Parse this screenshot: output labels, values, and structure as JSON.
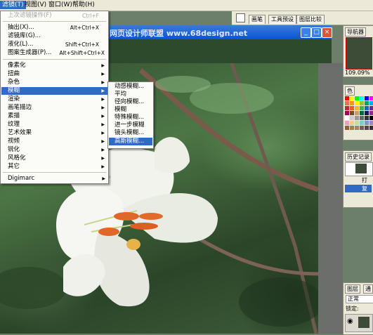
{
  "menubar": {
    "items": [
      {
        "label": "滤镜(T)",
        "active": true
      },
      {
        "label": "视图(V)",
        "active": false
      },
      {
        "label": "窗口(W)",
        "active": false
      },
      {
        "label": "帮助(H)",
        "active": false
      }
    ]
  },
  "filter_menu": {
    "items": [
      {
        "label": "上次滤镜操作(F)",
        "shortcut": "Ctrl+F",
        "disabled": true
      },
      {
        "label": "抽出(X)...",
        "shortcut": "Alt+Ctrl+X"
      },
      {
        "label": "滤镜库(G)...",
        "shortcut": ""
      },
      {
        "label": "液化(L)...",
        "shortcut": "Shift+Ctrl+X"
      },
      {
        "label": "图案生成器(P)...",
        "shortcut": "Alt+Shift+Ctrl+X"
      },
      {
        "label": "像素化",
        "submenu": true
      },
      {
        "label": "扭曲",
        "submenu": true
      },
      {
        "label": "杂色",
        "submenu": true
      },
      {
        "label": "模糊",
        "submenu": true,
        "highlighted": true
      },
      {
        "label": "渲染",
        "submenu": true
      },
      {
        "label": "画笔描边",
        "submenu": true
      },
      {
        "label": "素描",
        "submenu": true
      },
      {
        "label": "纹理",
        "submenu": true
      },
      {
        "label": "艺术效果",
        "submenu": true
      },
      {
        "label": "视频",
        "submenu": true
      },
      {
        "label": "锐化",
        "submenu": true
      },
      {
        "label": "风格化",
        "submenu": true
      },
      {
        "label": "其它",
        "submenu": true
      },
      {
        "label": "Digimarc",
        "submenu": true
      }
    ]
  },
  "blur_submenu": {
    "items": [
      {
        "label": "动感模糊..."
      },
      {
        "label": "平均"
      },
      {
        "label": "径向模糊..."
      },
      {
        "label": "模糊"
      },
      {
        "label": "特殊模糊..."
      },
      {
        "label": "进一步模糊"
      },
      {
        "label": "镜头模糊..."
      },
      {
        "label": "高斯模糊...",
        "highlighted": true
      }
    ]
  },
  "document": {
    "title": "网页设计师联盟 www.68design.net"
  },
  "toolbar_tabs": [
    "画笔",
    "工具预设",
    "图层比较"
  ],
  "panels": {
    "navigator_tab": "导航器",
    "zoom": "109.09%",
    "color_tab": "色",
    "history_tab": "历史记录",
    "history_items": [
      "打",
      "复"
    ],
    "layers_tab": "图层",
    "layers_tab2": "通",
    "blend_mode": "正常",
    "lock_label": "锁定:"
  },
  "colors": {
    "menu_highlight": "#316ac5",
    "titlebar": "#0a53d8"
  }
}
